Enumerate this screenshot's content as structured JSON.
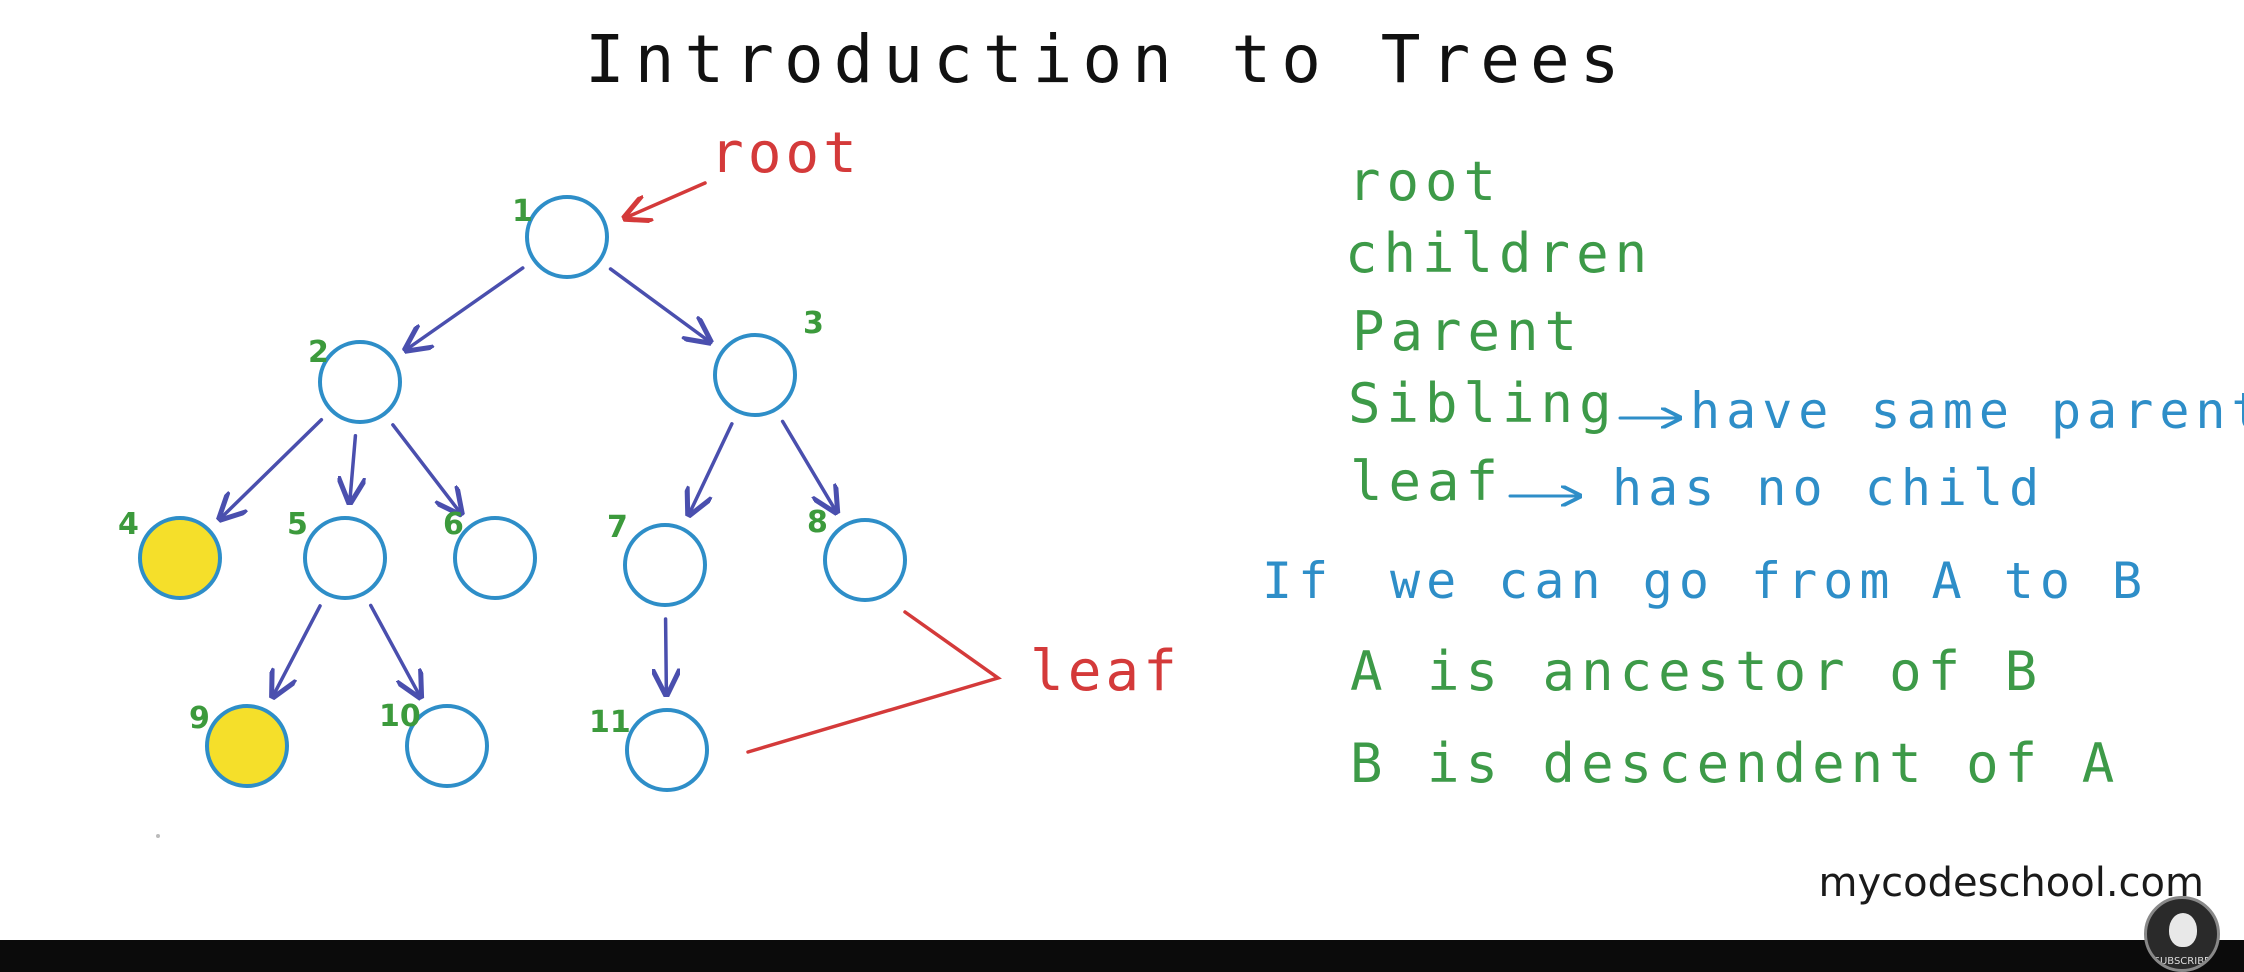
{
  "title": "Introduction to Trees",
  "tree": {
    "nodes": [
      {
        "id": "1",
        "label": "1",
        "filled": false
      },
      {
        "id": "2",
        "label": "2",
        "filled": false
      },
      {
        "id": "3",
        "label": "3",
        "filled": false
      },
      {
        "id": "4",
        "label": "4",
        "filled": true
      },
      {
        "id": "5",
        "label": "5",
        "filled": false
      },
      {
        "id": "6",
        "label": "6",
        "filled": false
      },
      {
        "id": "7",
        "label": "7",
        "filled": false
      },
      {
        "id": "8",
        "label": "8",
        "filled": false
      },
      {
        "id": "9",
        "label": "9",
        "filled": true
      },
      {
        "id": "10",
        "label": "10",
        "filled": false
      },
      {
        "id": "11",
        "label": "11",
        "filled": false
      }
    ],
    "edges": [
      {
        "from": "1",
        "to": "2"
      },
      {
        "from": "1",
        "to": "3"
      },
      {
        "from": "2",
        "to": "4"
      },
      {
        "from": "2",
        "to": "5"
      },
      {
        "from": "2",
        "to": "6"
      },
      {
        "from": "3",
        "to": "7"
      },
      {
        "from": "3",
        "to": "8"
      },
      {
        "from": "5",
        "to": "9"
      },
      {
        "from": "5",
        "to": "10"
      },
      {
        "from": "7",
        "to": "11"
      }
    ],
    "root_note": "root",
    "leaf_note": "leaf"
  },
  "terms": {
    "root": "root",
    "children": "children",
    "parent": "Parent",
    "sibling": "Sibling",
    "sibling_def": "have same parent",
    "leaf": "leaf",
    "leaf_def": "has no child"
  },
  "relations": {
    "condition_if": "If",
    "condition_rest": "we can go from A to B",
    "ancestor": "A is ancestor of B",
    "descendant": "B is descendent of A"
  },
  "colors": {
    "node_fill_highlight": "#f5df2a",
    "node_fill_default": "#ffffff"
  },
  "watermark": "mycodeschool.com",
  "subscribe_label": "SUBSCRIBE"
}
